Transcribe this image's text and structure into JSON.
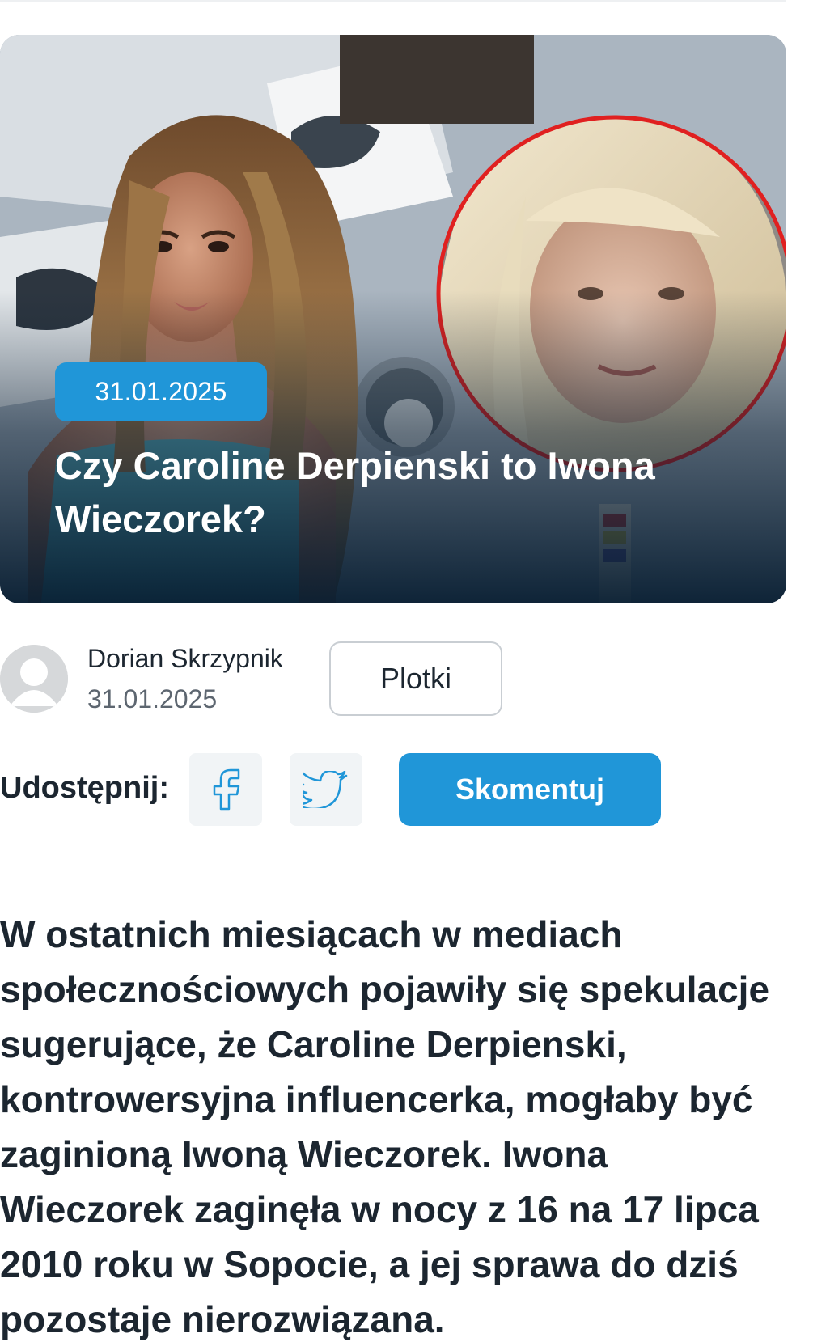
{
  "article": {
    "date_badge": "31.01.2025",
    "title": "Czy Caroline Derpienski to Iwona Wieczorek?",
    "author": {
      "name": "Dorian Skrzypnik",
      "date": "31.01.2025"
    },
    "category": "Plotki",
    "share": {
      "label": "Udostępnij:",
      "facebook_icon": "facebook-icon",
      "twitter_icon": "twitter-icon"
    },
    "comment_label": "Skomentuj",
    "lead": "W ostatnich miesiącach w mediach społecznościowych pojawiły się spekulacje sugerujące, że Caroline Derpienski, kontrowersyjna influencerka, mogłaby być zaginioną Iwoną Wieczorek. Iwona Wieczorek zaginęła w nocy z 16 na 17 lipca 2010 roku w Sopocie, a jej sprawa do dziś pozostaje nierozwiązana."
  },
  "colors": {
    "accent": "#2096d8",
    "text": "#1c2630",
    "muted": "#5d6670",
    "highlight_ring": "#e02020"
  }
}
